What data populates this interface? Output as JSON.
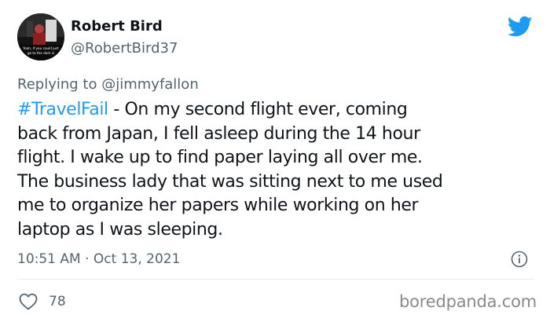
{
  "author": {
    "name": "Robert Bird",
    "handle": "@RobertBird37",
    "avatar_caption_line1": "Yeah, if you could just",
    "avatar_caption_line2": "go to the dark si"
  },
  "reply": {
    "prefix": "Replying to",
    "mention": "@jimmyfallon"
  },
  "tweet": {
    "hashtag": "#TravelFail",
    "line1_rest": " - On my second flight ever, coming",
    "line2": "back from Japan, I fell asleep during the 14 hour",
    "line3": "flight. I wake up to find paper laying all over me.",
    "line4": "The business lady that was sitting next to me used",
    "line5": "me to organize her papers while working on her",
    "line6": "laptop as I was sleeping."
  },
  "meta": {
    "timestamp": "10:51 AM · Oct 13, 2021"
  },
  "engagement": {
    "likes": "78"
  },
  "watermark": "boredpanda.com",
  "icons": {
    "brand": "twitter-bird-icon",
    "info": "info-icon",
    "like": "heart-icon"
  },
  "colors": {
    "accent": "#1d9bf0",
    "text": "#0f1419",
    "secondary": "#536471"
  }
}
